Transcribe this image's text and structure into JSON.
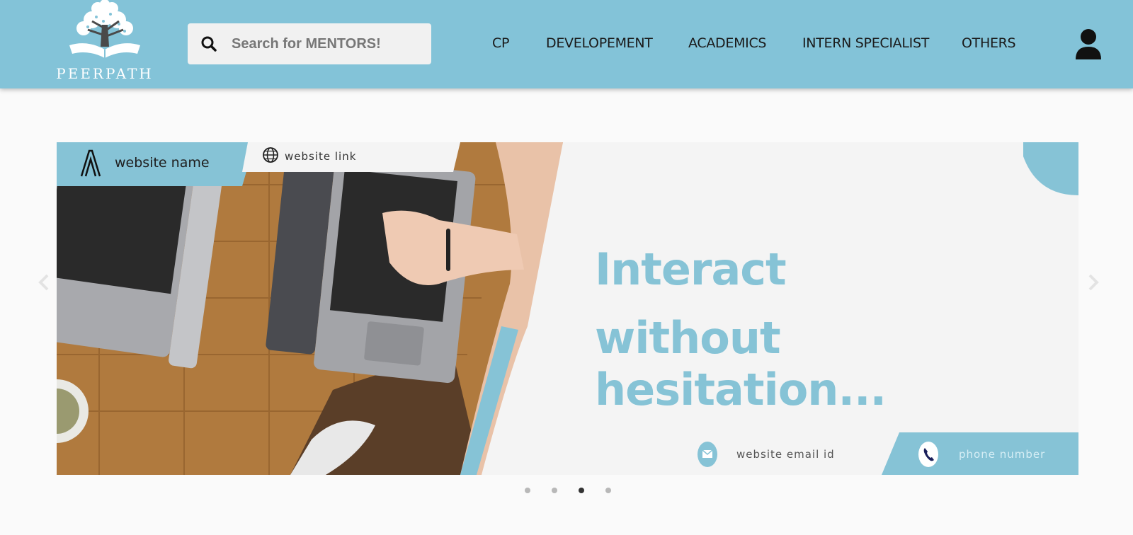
{
  "header": {
    "logo_text": "PEERPATH",
    "search": {
      "placeholder": "Search for MENTORS!",
      "value": ""
    },
    "nav": [
      {
        "label": "CP"
      },
      {
        "label": "DEVELOPEMENT"
      },
      {
        "label": "ACADEMICS"
      },
      {
        "label": "INTERN SPECIALIST"
      },
      {
        "label": "OTHERS"
      }
    ]
  },
  "carousel": {
    "slide": {
      "website_name": "website name",
      "website_link": "website link",
      "headline_line1": "Interact",
      "headline_line2": "without hesitation...",
      "email_label": "website email id",
      "phone_label": "phone number"
    },
    "active_index": 2,
    "slide_count": 4
  },
  "colors": {
    "header_bg": "#83c3d8",
    "accent": "#86c3d6",
    "page_bg": "#fafafa"
  }
}
